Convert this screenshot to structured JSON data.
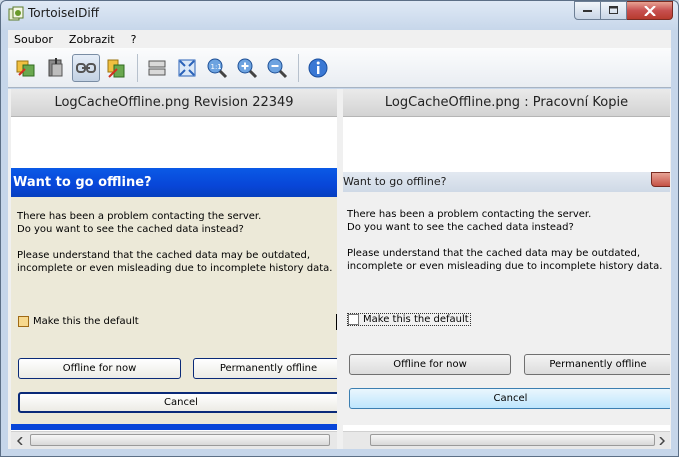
{
  "window": {
    "title": "TortoiseIDiff",
    "minimize_icon": "minimize-icon",
    "maximize_icon": "maximize-icon",
    "close_icon": "close-icon"
  },
  "menu": {
    "items": [
      "Soubor",
      "Zobrazit",
      "?"
    ]
  },
  "toolbar": {
    "icons": [
      {
        "name": "overlap-images-icon"
      },
      {
        "name": "blend-images-icon"
      },
      {
        "name": "link-images-icon",
        "active": true
      },
      {
        "name": "fit-images-icon"
      },
      {
        "name": "vertical-layout-icon"
      },
      {
        "name": "fit-together-icon"
      },
      {
        "name": "zoom-original-icon"
      },
      {
        "name": "zoom-in-icon"
      },
      {
        "name": "zoom-out-icon"
      },
      {
        "name": "image-info-icon"
      }
    ]
  },
  "left_pane": {
    "header": "LogCacheOffline.png Revision 22349",
    "dialog": {
      "title": "Want to go offline?",
      "line1": "There has been a problem contacting the server.",
      "line2": "Do you want to see the cached data instead?",
      "line3": "Please understand that the cached data may be outdated,",
      "line4": "incomplete or even misleading due to incomplete history data.",
      "checkbox_label": "Make this the default",
      "btn_offline": "Offline for now",
      "btn_permanent": "Permanently offline",
      "btn_cancel": "Cancel"
    }
  },
  "right_pane": {
    "header": "LogCacheOffline.png : Pracovní Kopie",
    "dialog": {
      "title": "Want to go offline?",
      "line1": "There has been a problem contacting the server.",
      "line2": "Do you want to see the cached data instead?",
      "line3": "Please understand that the cached data may be outdated,",
      "line4": "incomplete or even misleading due to incomplete history data.",
      "checkbox_label": "Make this the default",
      "btn_offline": "Offline for now",
      "btn_permanent": "Permanently offline",
      "btn_cancel": "Cancel"
    }
  },
  "colors": {
    "xp_title": "#0846d8",
    "xp_face": "#ece9d8",
    "w7_face": "#f0f0f0",
    "window_frame": "#c6d6ea"
  }
}
